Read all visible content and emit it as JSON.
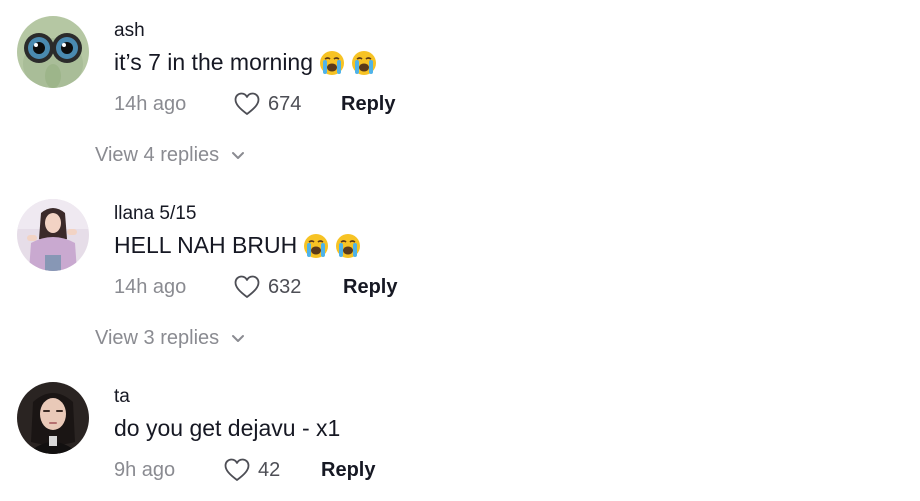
{
  "comments": [
    {
      "username": "ash",
      "text": "it’s 7 in the morning",
      "emojis": [
        "loudly-crying-face",
        "loudly-crying-face"
      ],
      "time": "14h ago",
      "likes": "674",
      "reply_label": "Reply",
      "view_replies": "View 4 replies"
    },
    {
      "username": "llana 5/15",
      "text": "HELL NAH BRUH",
      "emojis": [
        "loudly-crying-face",
        "loudly-crying-face"
      ],
      "time": "14h ago",
      "likes": "632",
      "reply_label": "Reply",
      "view_replies": "View 3 replies"
    },
    {
      "username": "ta",
      "text": "do you get dejavu - x1",
      "emojis": [],
      "time": "9h ago",
      "likes": "42",
      "reply_label": "Reply"
    }
  ],
  "icons": {
    "like": "heart-outline-icon",
    "expand": "chevron-down-icon",
    "emoji": "loudly-crying-face-emoji"
  },
  "colors": {
    "primary_text": "#161823",
    "secondary_text": "#8a8b91",
    "like_count": "#4d4e55",
    "background": "#ffffff"
  }
}
